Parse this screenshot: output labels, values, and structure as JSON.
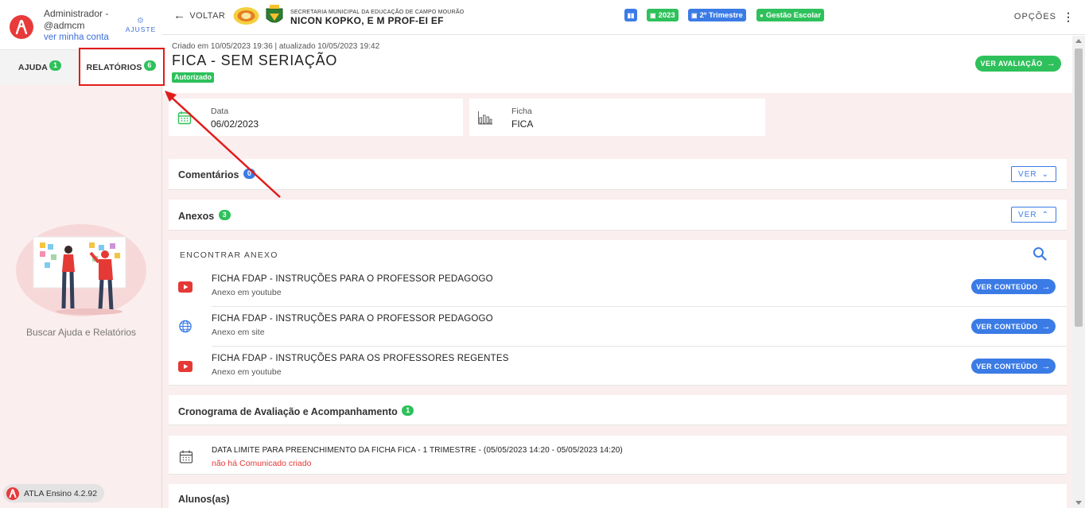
{
  "user": {
    "name": "Administrador -",
    "handle": "@admcm",
    "account_link": "ver minha conta",
    "settings_label": "AJUSTE"
  },
  "sidebar": {
    "tabs": [
      {
        "label": "AJUDA",
        "count": "1"
      },
      {
        "label": "RELATÓRIOS",
        "count": "6"
      }
    ],
    "help_text": "Buscar Ajuda e Relatórios",
    "version": "ATLA Ensino 4.2.92"
  },
  "header": {
    "back_label": "VOLTAR",
    "secretaria": "SECRETARIA MUNICIPAL DA EDUCAÇÃO DE CAMPO MOURÃO",
    "school": "NICON KOPKO, E M PROF-EI EF",
    "badges": [
      {
        "label": "",
        "icon": "chart-icon",
        "color": "#3b7be6"
      },
      {
        "label": "2023",
        "icon": "calendar-icon",
        "color": "#2ec15b"
      },
      {
        "label": "2º Trimestre",
        "icon": "calendar-icon",
        "color": "#3b7be6"
      },
      {
        "label": "Gestão Escolar",
        "icon": "check-circle-icon",
        "color": "#2ec15b"
      }
    ],
    "options_label": "OPÇÕES"
  },
  "record": {
    "meta": "Criado em 10/05/2023 19:36 | atualizado 10/05/2023 19:42",
    "title": "FICA - SEM SERIAÇÃO",
    "status": "Autorizado",
    "action_label": "VER AVALIAÇÃO"
  },
  "info_cards": [
    {
      "label": "Data",
      "value": "06/02/2023",
      "icon": "calendar-icon"
    },
    {
      "label": "Ficha",
      "value": "FICA",
      "icon": "bar-chart-icon"
    }
  ],
  "comments": {
    "title": "Comentários",
    "count": "0",
    "button": "VER"
  },
  "attachments": {
    "title": "Anexos",
    "count": "3",
    "button": "VER",
    "search_label": "ENCONTRAR ANEXO",
    "items": [
      {
        "title": "FICHA FDAP - INSTRUÇÕES PARA O PROFESSOR PEDAGOGO",
        "subtitle": "Anexo em youtube",
        "icon": "youtube-icon",
        "button": "VER CONTEÚDO"
      },
      {
        "title": "FICHA FDAP - INSTRUÇÕES PARA O PROFESSOR PEDAGOGO",
        "subtitle": "Anexo em site",
        "icon": "globe-icon",
        "button": "VER CONTEÚDO"
      },
      {
        "title": "FICHA FDAP - INSTRUÇÕES PARA OS PROFESSORES REGENTES",
        "subtitle": "Anexo em youtube",
        "icon": "youtube-icon",
        "button": "VER CONTEÚDO"
      }
    ]
  },
  "schedule": {
    "title": "Cronograma de Avaliação e Acompanhamento",
    "count": "1",
    "items": [
      {
        "title": "DATA LIMITE PARA PREENCHIMENTO DA FICHA FICA - 1 TRIMESTRE - (05/05/2023 14:20 - 05/05/2023 14:20)",
        "subtitle": "não há Comunicado criado"
      }
    ]
  },
  "students": {
    "title": "Alunos(as)"
  },
  "colors": {
    "accent_green": "#2ec15b",
    "accent_blue": "#3b7be6",
    "brand_red": "#e83a3a",
    "annotation_red": "#e21b1b"
  }
}
